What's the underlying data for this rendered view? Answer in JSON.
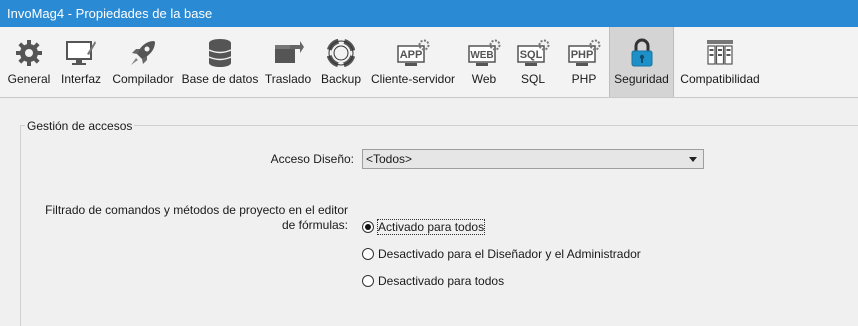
{
  "window": {
    "title": "InvoMag4 - Propiedades de la base"
  },
  "toolbar": {
    "items": [
      {
        "label": "General",
        "icon": "gear-icon"
      },
      {
        "label": "Interfaz",
        "icon": "monitor-pencil-icon"
      },
      {
        "label": "Compilador",
        "icon": "rocket-icon"
      },
      {
        "label": "Base de datos",
        "icon": "database-icon"
      },
      {
        "label": "Traslado",
        "icon": "box-arrow-icon"
      },
      {
        "label": "Backup",
        "icon": "lifebuoy-icon"
      },
      {
        "label": "Cliente-servidor",
        "icon": "app-gear-icon",
        "tag": "APP"
      },
      {
        "label": "Web",
        "icon": "web-gear-icon",
        "tag": "WEB"
      },
      {
        "label": "SQL",
        "icon": "sql-gear-icon",
        "tag": "SQL"
      },
      {
        "label": "PHP",
        "icon": "php-gear-icon",
        "tag": "PHP"
      },
      {
        "label": "Seguridad",
        "icon": "lock-icon",
        "selected": true
      },
      {
        "label": "Compatibilidad",
        "icon": "server-rack-icon"
      }
    ]
  },
  "access": {
    "group_title": "Gestión de accesos",
    "design_access_label": "Acceso Diseño:",
    "design_access_value": "<Todos>",
    "filter_label_line1": "Filtrado de comandos y métodos de proyecto en el editor",
    "filter_label_line2": "de fórmulas:",
    "options": [
      {
        "label": "Activado para todos",
        "selected": true
      },
      {
        "label": "Desactivado para el Diseñador y el Administrador",
        "selected": false
      },
      {
        "label": "Desactivado para todos",
        "selected": false
      }
    ]
  },
  "colors": {
    "titlebar": "#2a8ad4",
    "selected_tab": "#d4d4d4"
  }
}
